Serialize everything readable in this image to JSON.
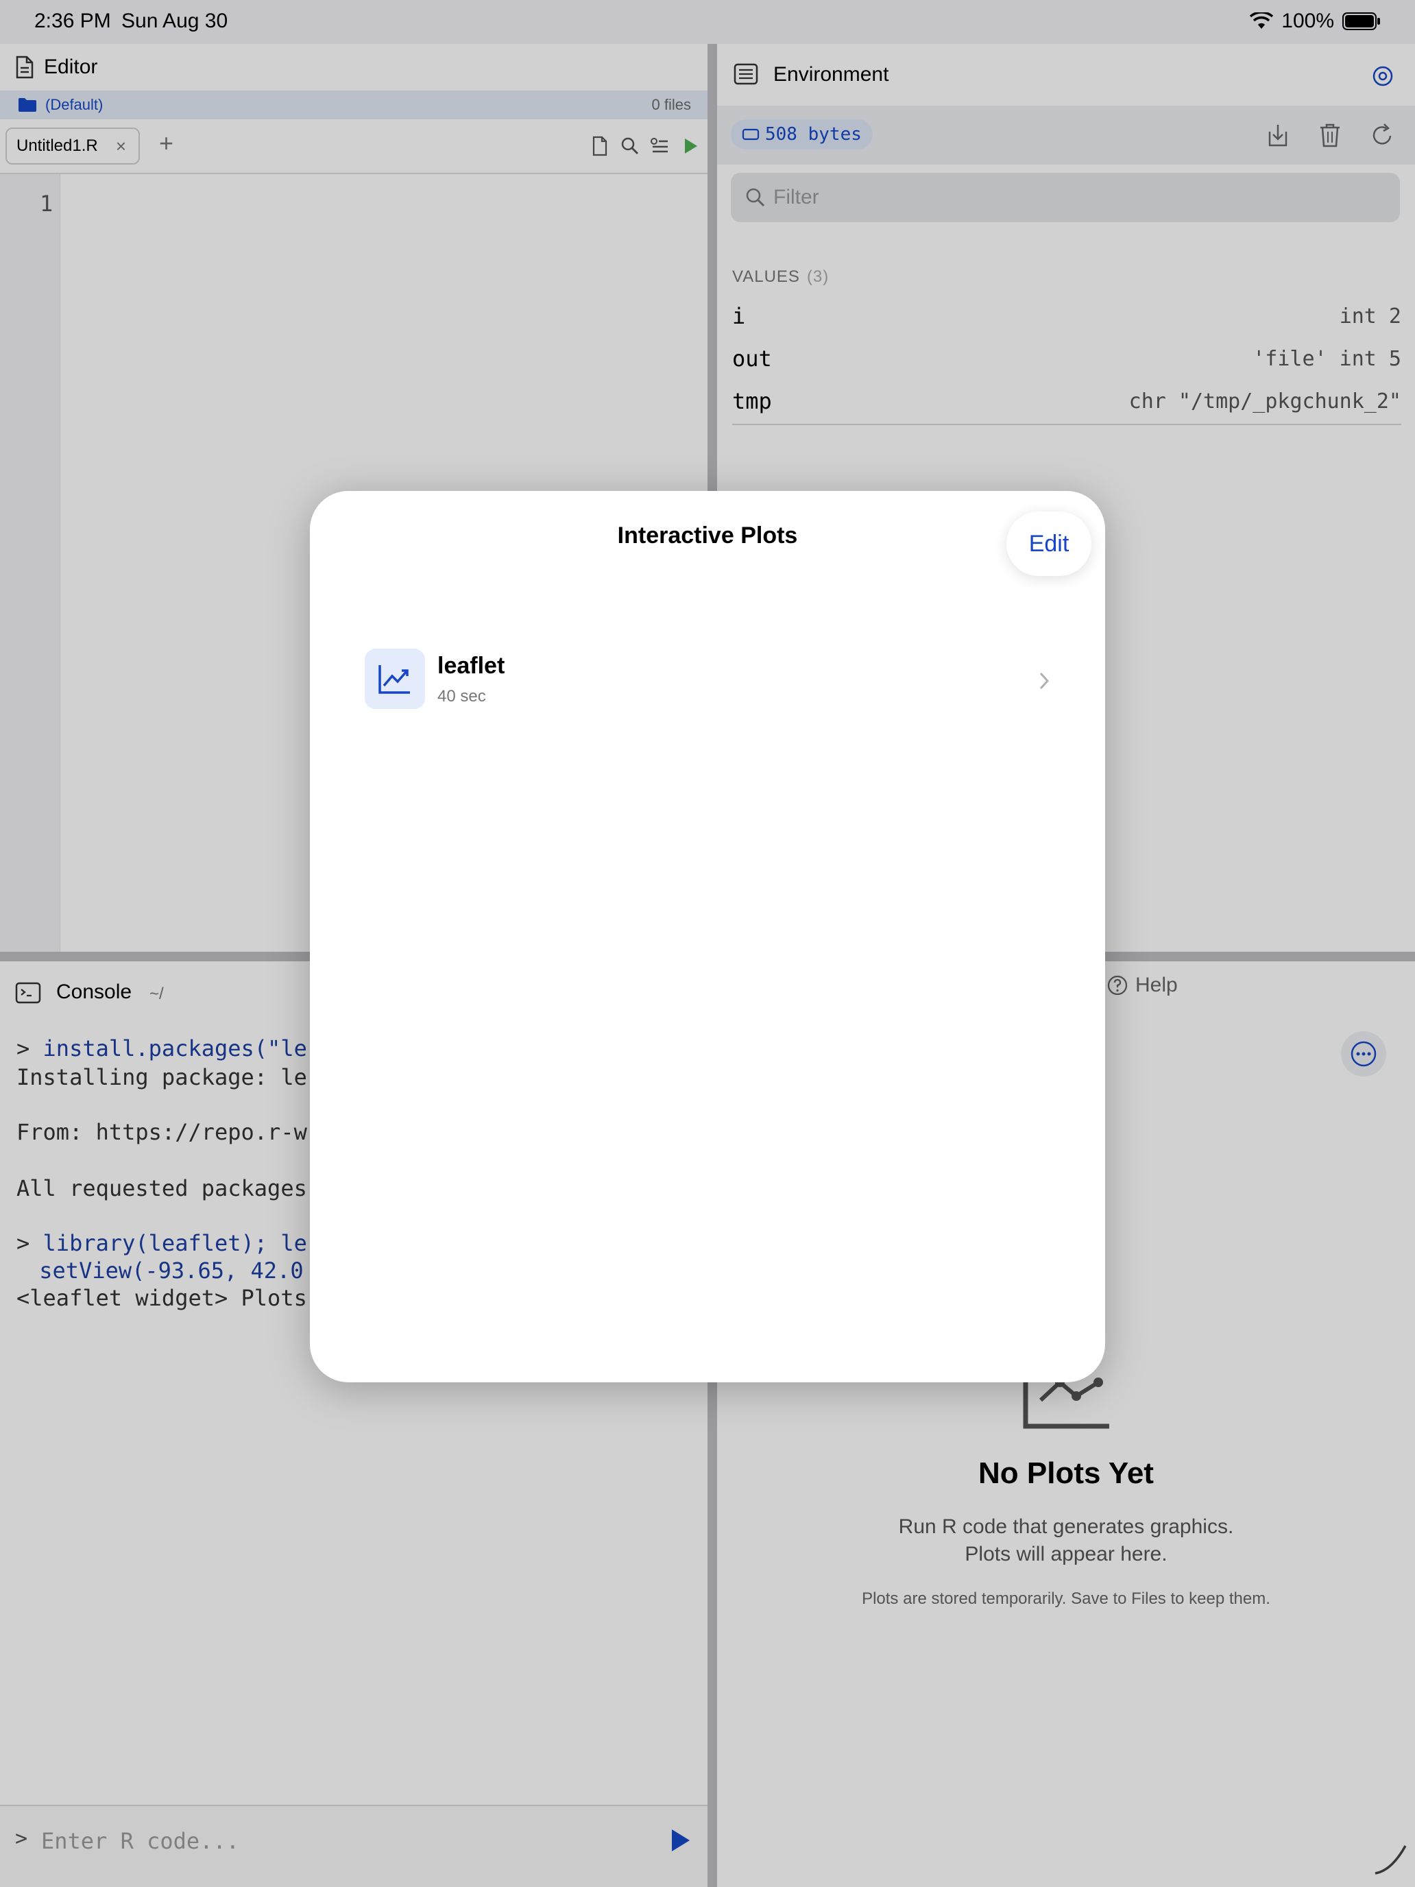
{
  "status_bar": {
    "time": "2:36 PM",
    "date": "Sun Aug 30",
    "battery": "100%"
  },
  "editor": {
    "title": "Editor",
    "project_name": "(Default)",
    "project_files": "0 files",
    "tab_label": "Untitled1.R",
    "tab_close": "×",
    "add_tab": "+",
    "line_numbers": [
      "1"
    ]
  },
  "environment": {
    "title": "Environment",
    "size_badge": "508 bytes",
    "filter_placeholder": "Filter",
    "values_label": "VALUES",
    "values_count": "(3)",
    "variables": [
      {
        "name": "i",
        "value": "int 2"
      },
      {
        "name": "out",
        "value": "'file' int 5"
      },
      {
        "name": "tmp",
        "value": "chr \"/tmp/_pkgchunk_2\""
      }
    ]
  },
  "console": {
    "title": "Console",
    "path": "~/",
    "lines": [
      {
        "prompt": ">",
        "text": "install.packages(\"le",
        "is_cmd": true
      },
      {
        "prompt": "",
        "text": "Installing package: le",
        "is_cmd": false
      },
      {
        "prompt": "",
        "text": "",
        "is_cmd": false
      },
      {
        "prompt": "",
        "text": "From: https://repo.r-w",
        "is_cmd": false
      },
      {
        "prompt": "",
        "text": "",
        "is_cmd": false
      },
      {
        "prompt": "",
        "text": "All requested packages",
        "is_cmd": false
      },
      {
        "prompt": "",
        "text": "",
        "is_cmd": false
      },
      {
        "prompt": ">",
        "text": "library(leaflet); le",
        "is_cmd": true
      },
      {
        "prompt": "",
        "text": " setView(-93.65, 42.0",
        "is_cmd": true
      },
      {
        "prompt": "",
        "text": "<leaflet widget> Plots",
        "is_cmd": false
      }
    ],
    "input_prompt": ">",
    "input_placeholder": "Enter R code..."
  },
  "plots_pane": {
    "help_tab": "Help",
    "empty_title": "No Plots Yet",
    "empty_line1": "Run R code that generates graphics.",
    "empty_line2": "Plots will appear here.",
    "empty_note": "Plots are stored temporarily. Save to Files to keep them."
  },
  "modal": {
    "title": "Interactive Plots",
    "edit_label": "Edit",
    "items": [
      {
        "name": "leaflet",
        "time": "40 sec"
      }
    ]
  },
  "colors": {
    "accent": "#1747c7",
    "run_green": "#4caf50"
  },
  "icons": [
    "document-icon",
    "folder-icon",
    "new-file-icon",
    "search-icon",
    "format-icon",
    "run-icon",
    "environment-icon",
    "settings-icon",
    "import-icon",
    "trash-icon",
    "refresh-icon",
    "terminal-icon",
    "help-icon",
    "more-icon",
    "chart-icon",
    "chevron-right-icon",
    "send-icon",
    "wifi-icon",
    "battery-icon",
    "memory-icon"
  ]
}
